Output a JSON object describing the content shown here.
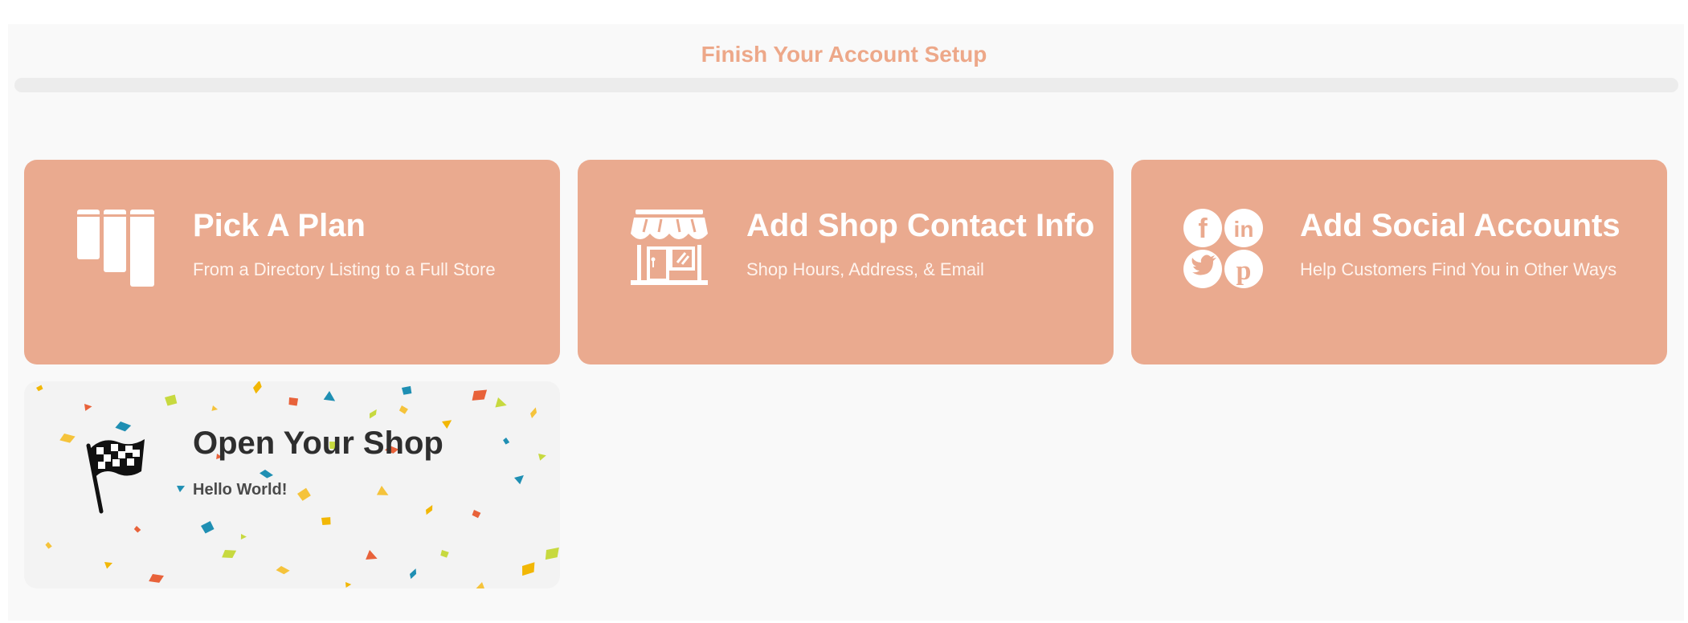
{
  "header": {
    "title": "Finish Your Account Setup",
    "progress_percent": 0
  },
  "cards": [
    {
      "title": "Pick A Plan",
      "subtitle": "From a Directory Listing to a Full Store",
      "icon": "plan-columns-icon"
    },
    {
      "title": "Add Shop Contact Info",
      "subtitle": "Shop Hours, Address, & Email",
      "icon": "storefront-icon"
    },
    {
      "title": "Add Social Accounts",
      "subtitle": "Help Customers Find You in Other Ways",
      "icon": "social-icons-cluster"
    },
    {
      "title": "Open Your Shop",
      "subtitle": "Hello World!",
      "icon": "checkered-flag-icon"
    }
  ],
  "colors": {
    "accent": "#eaaa8f",
    "title_accent": "#eda889",
    "confetti": [
      "#f2b705",
      "#e8623a",
      "#1f8fb3",
      "#c7d93f",
      "#f5c33b"
    ]
  }
}
